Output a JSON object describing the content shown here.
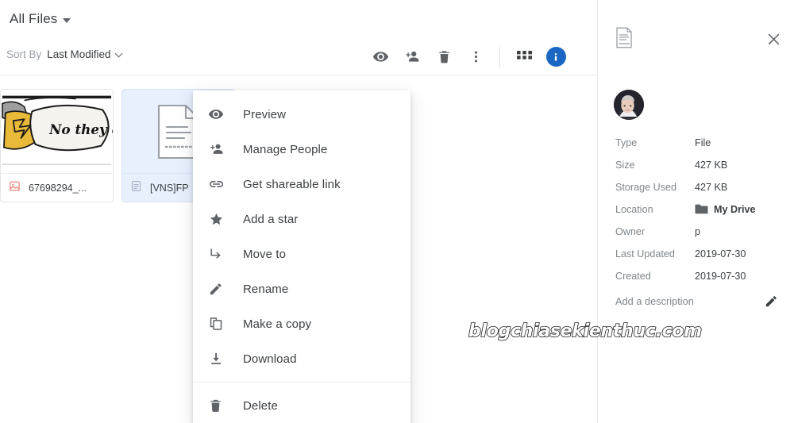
{
  "header": {
    "title": "All Files",
    "dropdown_icon": "caret-down-icon"
  },
  "toolbar": {
    "sort_by_label": "Sort By",
    "sort_value": "Last Modified",
    "buttons": [
      {
        "name": "preview-icon",
        "label": "Preview"
      },
      {
        "name": "manage-people-icon",
        "label": "Manage People"
      },
      {
        "name": "delete-icon",
        "label": "Delete"
      },
      {
        "name": "more-vert-icon",
        "label": "More"
      },
      {
        "name": "grid-view-icon",
        "label": "Grid view"
      },
      {
        "name": "info-icon",
        "label": "Info"
      }
    ],
    "info_glyph": "i",
    "info_color": "#1a67c4"
  },
  "files": [
    {
      "name": "67698294_...",
      "type_icon": "image-file-icon",
      "selected": false,
      "thumb_text": "No they c"
    },
    {
      "name": "[VNS]FP",
      "type_icon": "document-file-icon",
      "selected": true,
      "thumb_text": ""
    }
  ],
  "context_menu": {
    "items": [
      {
        "icon": "eye-icon",
        "label": "Preview"
      },
      {
        "icon": "person-add-icon",
        "label": "Manage People"
      },
      {
        "icon": "link-icon",
        "label": "Get shareable link"
      },
      {
        "icon": "star-icon",
        "label": "Add a star"
      },
      {
        "icon": "move-to-icon",
        "label": "Move to"
      },
      {
        "icon": "pencil-icon",
        "label": "Rename"
      },
      {
        "icon": "copy-icon",
        "label": "Make a copy"
      },
      {
        "icon": "download-icon",
        "label": "Download"
      }
    ],
    "destructive": {
      "icon": "trash-icon",
      "label": "Delete"
    }
  },
  "details_panel": {
    "file_icon": "document-icon",
    "close_icon": "close-icon",
    "avatar": "owner-avatar",
    "rows": [
      {
        "key": "Type",
        "value": "File",
        "bold": false,
        "icon": ""
      },
      {
        "key": "Size",
        "value": "427 KB",
        "bold": false,
        "icon": ""
      },
      {
        "key": "Storage Used",
        "value": "427 KB",
        "bold": false,
        "icon": ""
      },
      {
        "key": "Location",
        "value": "My Drive",
        "bold": true,
        "icon": "folder-icon"
      },
      {
        "key": "Owner",
        "value": "p",
        "bold": false,
        "icon": ""
      },
      {
        "key": "Last Updated",
        "value": "2019-07-30",
        "bold": false,
        "icon": ""
      },
      {
        "key": "Created",
        "value": "2019-07-30",
        "bold": false,
        "icon": ""
      }
    ],
    "add_description_label": "Add a description",
    "edit_icon": "pencil-icon"
  },
  "watermark": {
    "text": "blogchiasekienthuc.com"
  }
}
